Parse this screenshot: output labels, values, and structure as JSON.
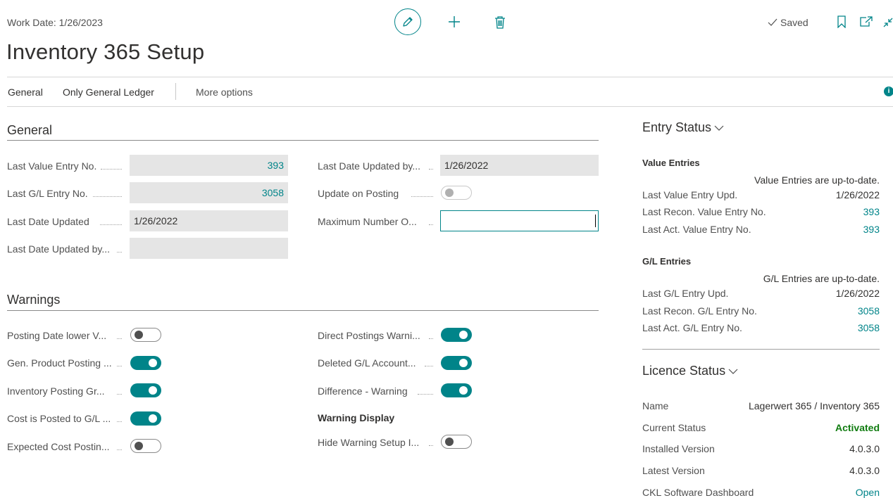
{
  "header": {
    "work_date": "Work Date: 1/26/2023",
    "title": "Inventory 365 Setup",
    "saved": "Saved"
  },
  "actions": {
    "general": "General",
    "only_gl": "Only General Ledger",
    "more": "More options",
    "info_glyph": "i"
  },
  "general": {
    "heading": "General",
    "left": [
      {
        "label": "Last Value Entry No.",
        "value": "393"
      },
      {
        "label": "Last G/L Entry No.",
        "value": "3058"
      },
      {
        "label": "Last Date Updated",
        "value": "1/26/2022"
      },
      {
        "label": "Last Date Updated by...",
        "value": ""
      }
    ],
    "right": {
      "date_updated_by_label": "Last Date Updated by...",
      "date_updated_by_value": "1/26/2022",
      "update_on_posting_label": "Update on Posting",
      "update_on_posting": false,
      "max_number_label": "Maximum Number O...",
      "max_number_value": ""
    }
  },
  "warnings": {
    "heading": "Warnings",
    "left": [
      {
        "label": "Posting Date lower V...",
        "on": false
      },
      {
        "label": "Gen. Product Posting ...",
        "on": true
      },
      {
        "label": "Inventory Posting Gr...",
        "on": true
      },
      {
        "label": "Cost is Posted to G/L ...",
        "on": true
      },
      {
        "label": "Expected Cost Postin...",
        "on": false
      }
    ],
    "right": [
      {
        "label": "Direct Postings Warni...",
        "on": true
      },
      {
        "label": "Deleted G/L Account...",
        "on": true
      },
      {
        "label": "Difference - Warning",
        "on": true
      }
    ],
    "display_heading": "Warning Display",
    "hide_setup_label": "Hide Warning Setup I...",
    "hide_setup_on": false
  },
  "entry_status": {
    "title": "Entry Status",
    "value_entries": {
      "heading": "Value Entries",
      "status": "Value Entries are up-to-date.",
      "rows": [
        {
          "label": "Last Value Entry Upd.",
          "value": "1/26/2022"
        },
        {
          "label": "Last Recon. Value Entry No.",
          "value": "393"
        },
        {
          "label": "Last Act. Value Entry No.",
          "value": "393"
        }
      ]
    },
    "gl_entries": {
      "heading": "G/L Entries",
      "status": "G/L Entries are up-to-date.",
      "rows": [
        {
          "label": "Last G/L Entry Upd.",
          "value": "1/26/2022"
        },
        {
          "label": "Last Recon. G/L Entry No.",
          "value": "3058"
        },
        {
          "label": "Last Act. G/L Entry No.",
          "value": "3058"
        }
      ]
    }
  },
  "licence_status": {
    "title": "Licence Status",
    "rows": [
      {
        "label": "Name",
        "value": "Lagerwert 365 / Inventory 365"
      },
      {
        "label": "Current Status",
        "value": "Activated"
      },
      {
        "label": "Installed Version",
        "value": "4.0.3.0"
      },
      {
        "label": "Latest Version",
        "value": "4.0.3.0"
      },
      {
        "label": "CKL Software Dashboard",
        "value": "Open"
      }
    ]
  },
  "colors": {
    "accent": "#008489",
    "activated": "#107c10"
  }
}
